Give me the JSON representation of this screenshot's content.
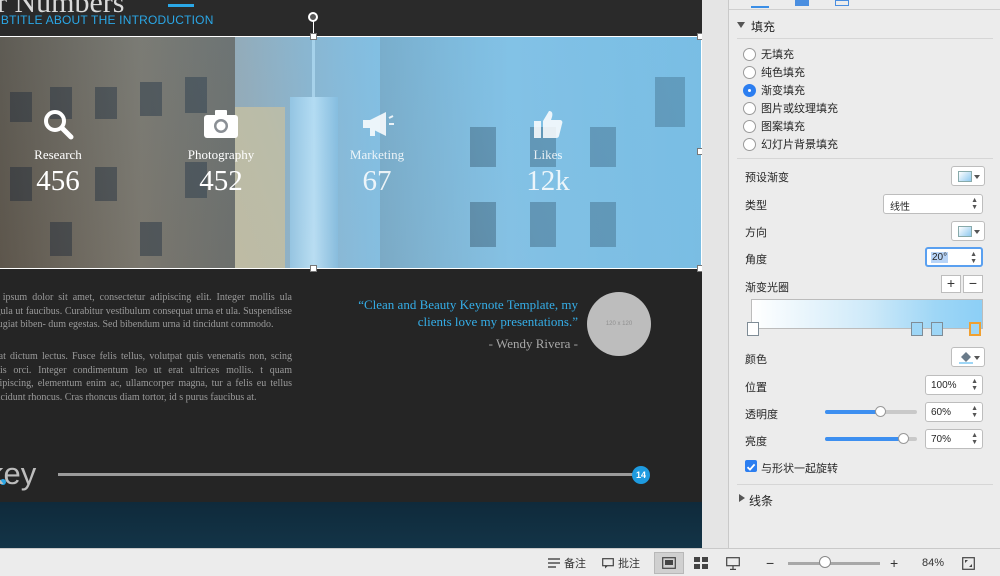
{
  "slide": {
    "title_fragment": "ur Numbers",
    "subtitle": "UBTITLE ABOUT THE INTRODUCTION",
    "stats": [
      {
        "label": "Research",
        "value": "456",
        "icon": "search-icon"
      },
      {
        "label": "Photography",
        "value": "452",
        "icon": "camera-icon"
      },
      {
        "label": "Marketing",
        "value": "67",
        "icon": "megaphone-icon"
      },
      {
        "label": "Likes",
        "value": "12k",
        "icon": "thumbs-up-icon"
      }
    ],
    "paragraph_1": "m ipsum dolor sit amet, consectetur adipiscing elit. Integer mollis ula ligula ut faucibus. Curabitur vestibulum consequat urna et ula. Suspendisse feugiat biben- dum egestas. Sed bibendum urna id tincidunt commodo.",
    "paragraph_2": "c at dictum lectus. Fusce felis tellus, volutpat quis venenatis non, scing quis orci. Integer condimentum leo ut erat ultrices mollis. t quam adipiscing, elementum enim ac, ullamcorper magna, tur a felis eu tellus tincidunt rhoncus. Cras rhoncus diam tortor, id s purus faucibus at.",
    "quote": "“Clean and Beauty Keynote Template, my clients love my presentations.”",
    "quote_author": "- Wendy Rivera -",
    "placeholder_text": "120 x 120",
    "brand_fragment": "key",
    "page_number": "14"
  },
  "inspector": {
    "fill_section_title": "填充",
    "fill_options": [
      {
        "label": "无填充",
        "selected": false
      },
      {
        "label": "纯色填充",
        "selected": false
      },
      {
        "label": "渐变填充",
        "selected": true
      },
      {
        "label": "图片或纹理填充",
        "selected": false
      },
      {
        "label": "图案填充",
        "selected": false
      },
      {
        "label": "幻灯片背景填充",
        "selected": false
      }
    ],
    "preset_gradient_label": "预设渐变",
    "type_label": "类型",
    "type_value": "线性",
    "direction_label": "方向",
    "angle_label": "角度",
    "angle_value": "20°",
    "gradient_stops_label": "渐变光圈",
    "color_label": "颜色",
    "position_label": "位置",
    "position_value": "100%",
    "transparency_label": "透明度",
    "transparency_value": "60%",
    "transparency_level": 0.6,
    "brightness_label": "亮度",
    "brightness_value": "70%",
    "brightness_level": 0.85,
    "rotate_with_shape_label": "与形状一起旋转",
    "rotate_with_shape_checked": true,
    "line_section_title": "线条",
    "accent_color": "#2c7ef0"
  },
  "statusbar": {
    "notes_label": "备注",
    "comments_label": "批注",
    "zoom_value": "84%",
    "zoom_minus": "−",
    "zoom_plus": "+"
  }
}
